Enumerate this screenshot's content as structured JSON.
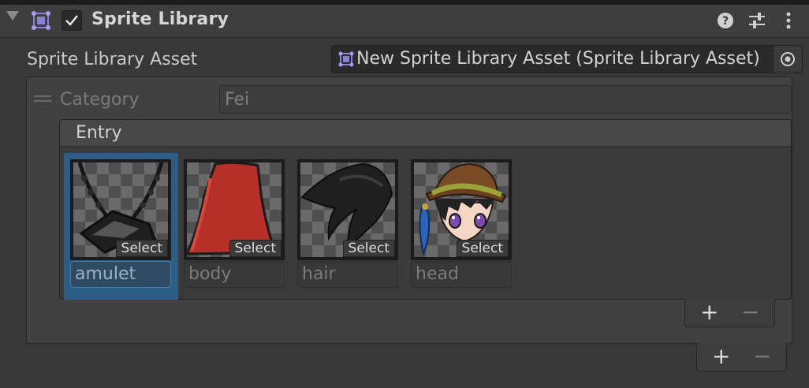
{
  "header": {
    "title": "Sprite Library",
    "enabled": true,
    "icons": [
      "component-icon",
      "help-icon",
      "presets-icon",
      "kebab-menu-icon"
    ]
  },
  "asset": {
    "label": "Sprite Library Asset",
    "value": "New Sprite Library Asset (Sprite Library Asset)"
  },
  "category": {
    "label": "Category",
    "value": "Fei"
  },
  "entry": {
    "title": "Entry",
    "select_label": "Select",
    "items": [
      {
        "name": "amulet",
        "selected": true
      },
      {
        "name": "body",
        "selected": false
      },
      {
        "name": "hair",
        "selected": false
      },
      {
        "name": "head",
        "selected": false
      }
    ]
  },
  "footer": {
    "add_symbol": "+",
    "remove_symbol": "−"
  },
  "colors": {
    "background": "#383838",
    "selection": "#2c5d87",
    "accent_icon": "#8c7fd6"
  }
}
